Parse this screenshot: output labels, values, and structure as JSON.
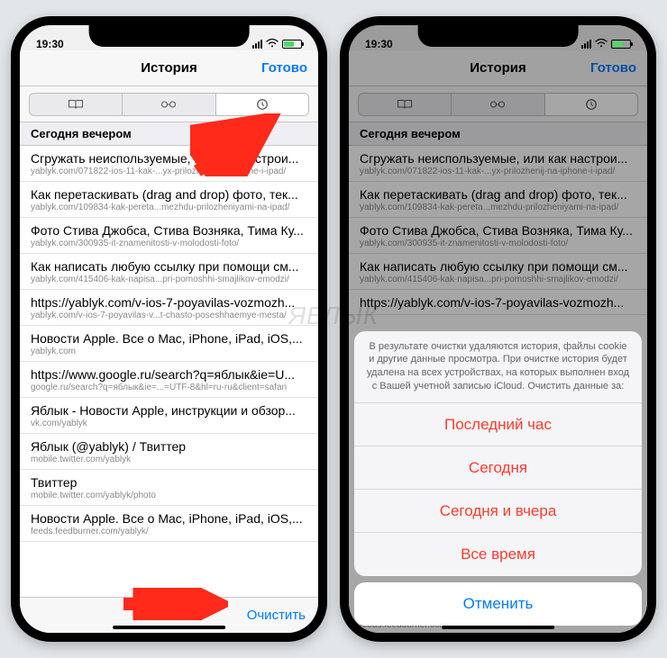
{
  "statusbar": {
    "time": "19:30"
  },
  "navbar": {
    "title": "История",
    "done": "Готово"
  },
  "section_header": "Сегодня вечером",
  "toolbar": {
    "clear": "Очистить"
  },
  "rows": [
    {
      "t": "Сгружать неиспользуемые, или как настрои...",
      "u": "yablyk.com/071822-ios-11-kak-...yx-prilozhenij-na-iphone-i-ipad/"
    },
    {
      "t": "Как перетаскивать (drag and drop) фото, тек...",
      "u": "yablyk.com/109834-kak-pereta...mezhdu-prilozheniyami-na-ipad/"
    },
    {
      "t": "Фото Стива Джобса, Стива Возняка, Тима Ку...",
      "u": "yablyk.com/300935-it-znamenitosti-v-molodosti-foto/"
    },
    {
      "t": "Как написать любую ссылку при помощи см...",
      "u": "yablyk.com/415406-kak-napisa...pri-pomoshhi-smajlikov-emodzi/"
    },
    {
      "t": "https://yablyk.com/v-ios-7-poyavilas-vozmozh...",
      "u": "yablyk.com/v-ios-7-poyavilas-v...t-chasto-poseshhaemye-mesta/"
    },
    {
      "t": "Новости Apple. Все о Mac, iPhone, iPad, iOS,...",
      "u": "yablyk.com"
    },
    {
      "t": "https://www.google.ru/search?q=яблык&ie=U...",
      "u": "google.ru/search?q=яблык&ie=...=UTF-8&hl=ru-ru&client=safari"
    },
    {
      "t": "Яблык - Новости Apple, инструкции и обзор...",
      "u": "vk.com/yablyk"
    },
    {
      "t": "Яблык (@yablyk) / Твиттер",
      "u": "mobile.twitter.com/yablyk"
    },
    {
      "t": "Твиттер",
      "u": "mobile.twitter.com/yablyk/photo"
    },
    {
      "t": "Новости Apple. Все о Mac, iPhone, iPad, iOS,...",
      "u": "feeds.feedburner.com/yablyk/"
    }
  ],
  "rows2": [
    {
      "t": "Сгружать неиспользуемые, или как настрои...",
      "u": "yablyk.com/071822-ios-11-kak-...yx-prilozhenij-na-iphone-i-ipad/"
    },
    {
      "t": "Как перетаскивать (drag and drop) фото, тек...",
      "u": "yablyk.com/109834-kak-pereta...mezhdu-prilozheniyami-na-ipad/"
    },
    {
      "t": "Фото Стива Джобса, Стива Возняка, Тима Ку...",
      "u": "yablyk.com/300935-it-znamenitosti-v-molodosti-foto/"
    },
    {
      "t": "Как написать любую ссылку при помощи см...",
      "u": "yablyk.com/415406-kak-napisa...pri-pomoshhi-smajlikov-emodzi/"
    },
    {
      "t": "https://yablyk.com/v-ios-7-poyavilas-vozmozh...",
      "u": ""
    }
  ],
  "sheet": {
    "message": "В результате очистки удаляются история, файлы cookie и другие данные просмотра. При очистке история будет удалена на всех устройствах, на которых выполнен вход с Вашей учетной записью iCloud. Очистить данные за:",
    "options": [
      "Последний час",
      "Сегодня",
      "Сегодня и вчера",
      "Все время"
    ],
    "cancel": "Отменить"
  },
  "row2_bottom_url": "feeds.feedburner.com/yablyk/",
  "watermark": "ЯБЛЫК"
}
